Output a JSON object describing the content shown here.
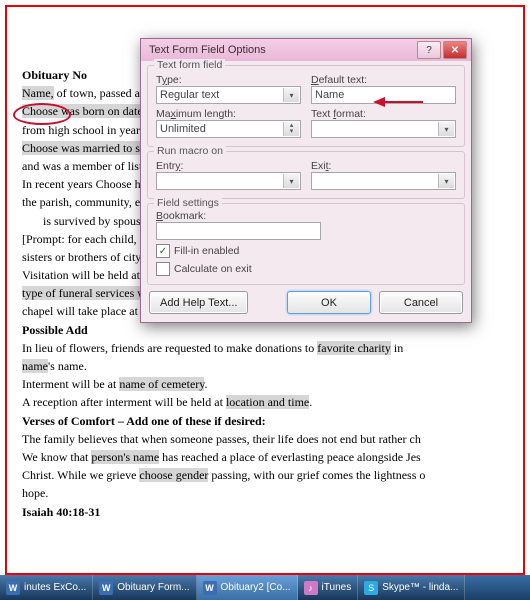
{
  "page_border_color": "#e00000",
  "doc": {
    "h1": "Obituary No",
    "name_field": "Name,",
    "p1a": " of town, passed away on date at location of passing and he or she was age.",
    "p2a": "Choose was born on date in town. He or she grew up in town of childhood",
    "p2b": "from high school in year graduated high school and attended list colleges attended, graduated",
    "p3a": "Choose was married to spouse's name for number years. He or she worked as an hob",
    "p3b": "and was a member of list organizations.",
    "p4a": "In recent years Choose has enjoyed list hobbies. Choose was a devoted member of the s",
    "p4b": "the parish, community, etc.",
    "p5a": " is survived by spouse's name,",
    "p6a": "[Prompt: for each child, list child's name and spouse's name, and number grandchildren dren",
    "p6b": "sisters or brothers of city of residence. Choose was preceded in death by list names or cov",
    "p7a": "Visitation will be held at funeral home and address on date and time.",
    "p8a": "type of funeral services will be held at location of funeral on date at time. Burial ho",
    "p8b": "chapel will take place at cemetery name.",
    "h2": "Possible Add",
    "p9a": "In lieu of flowers, friends are requested to make donations to ",
    "p9b": "favorite charity",
    "p9c": " in ",
    "p10a": "name",
    "p10b": "'s name.",
    "p11a": "Interment will be at ",
    "p11b": "name of cemetery",
    "p11c": ".",
    "p12a": "A reception after interment will be held at ",
    "p12b": "location and time",
    "p12c": ".",
    "h3": "Verses of Comfort – Add one of these if desired:",
    "p13a": "The family believes that when someone passes, their life does not end but rather ch",
    "p13b": "We know that ",
    "p13c": "person's name",
    "p13d": " has reached a place of everlasting peace alongside Jes",
    "p14a": "Christ. While we grieve ",
    "p14b": "choose gender",
    "p14c": " passing, with our grief comes the lightness o",
    "p15": "hope.",
    "h4": "Isaiah 40:18-31"
  },
  "dialog": {
    "title": "Text Form Field Options",
    "group1": "Text form field",
    "type_label": "T_ype:",
    "type_value": "Regular text",
    "default_label": "Default text:",
    "default_value": "Name",
    "maxlen_label": "Ma_ximum length:",
    "maxlen_value": "Unlimited",
    "format_label": "Text format:",
    "format_value": "",
    "group2": "Run macro on",
    "entry_label": "Entr_y:",
    "entry_value": "",
    "exit_label": "Exi_t:",
    "exit_value": "",
    "group3": "Field settings",
    "bookmark_label": "_Bookmark:",
    "bookmark_value": "",
    "fillin_label": "Fill-in enabled",
    "calc_label": "Calculate on exit",
    "addhelp": "Add Help Text...",
    "ok": "OK",
    "cancel": "Cancel"
  },
  "taskbar": {
    "items": [
      {
        "label": "inutes ExCo...",
        "icon": "W"
      },
      {
        "label": "Obituary Form...",
        "icon": "W"
      },
      {
        "label": "Obituary2  [Co...",
        "icon": "W"
      },
      {
        "label": "iTunes",
        "icon": "♪"
      },
      {
        "label": "Skype™ - linda...",
        "icon": "S"
      }
    ]
  }
}
